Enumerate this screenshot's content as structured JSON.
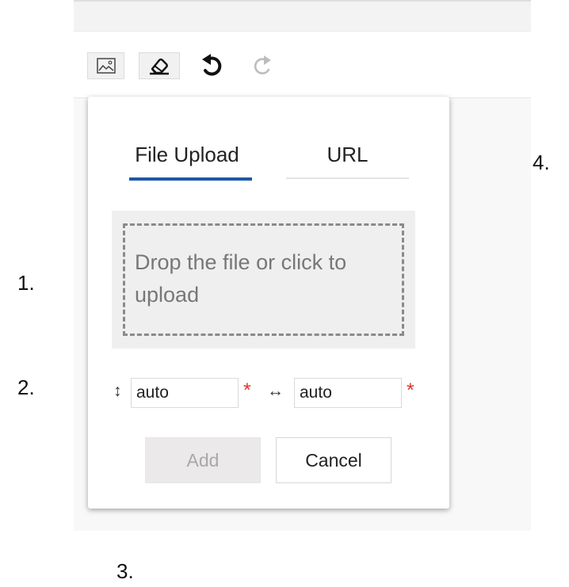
{
  "toolbar": {
    "icons": [
      "image-icon",
      "eraser-icon",
      "undo-icon",
      "redo-icon"
    ]
  },
  "popup": {
    "tabs": [
      {
        "label": "File Upload",
        "active": true
      },
      {
        "label": "URL",
        "active": false
      }
    ],
    "dropzone_text": "Drop the file or click to upload",
    "height_icon": "↕",
    "width_icon": "↔",
    "height_value": "auto",
    "width_value": "auto",
    "required_mark": "*",
    "add_label": "Add",
    "cancel_label": "Cancel"
  },
  "markers": [
    "1.",
    "2.",
    "3.",
    "4."
  ],
  "colors": {
    "accent": "#1e58a6",
    "required": "#e0352b",
    "disabled_text": "#a9a9a9"
  }
}
